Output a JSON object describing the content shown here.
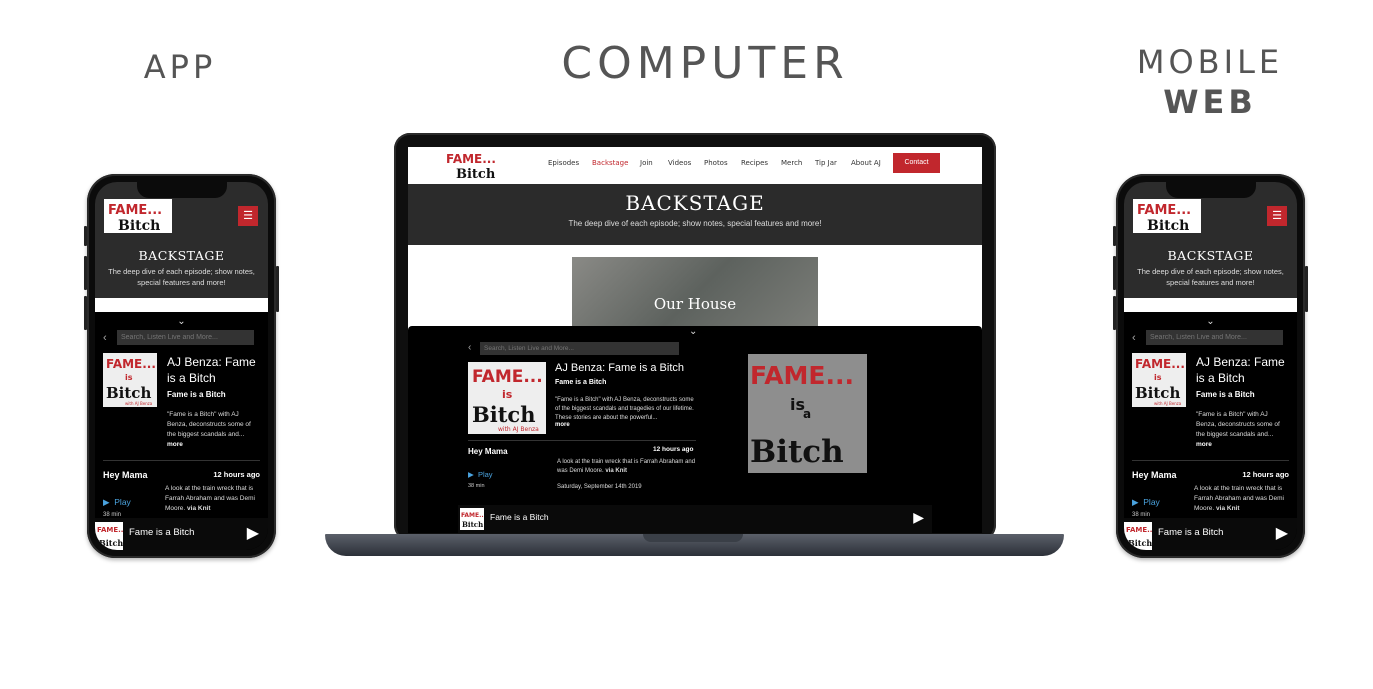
{
  "headings": {
    "app": "APP",
    "computer": "COMPUTER",
    "mobile_line1": "MOBILE",
    "mobile_line2": "WEB"
  },
  "site": {
    "nav": [
      "Episodes",
      "Backstage",
      "Join",
      "Videos",
      "Photos",
      "Recipes",
      "Merch",
      "Tip Jar",
      "About AJ"
    ],
    "active_nav": "Backstage",
    "contact_label": "Contact",
    "page_title": "BACKSTAGE",
    "page_subtitle": "The deep dive of each episode; show notes, special features and more!",
    "card_title": "Our House",
    "menu_icon": "hamburger-icon",
    "logo": {
      "line1": "FAME...",
      "line2": "Bitch"
    }
  },
  "player": {
    "search_placeholder": "Search, Listen Live and More...",
    "podcast_title": "AJ Benza: Fame is a Bitch",
    "podcast_name": "Fame is a Bitch",
    "desc_short": "\"Fame is a Bitch\" with AJ Benza, deconstructs some of the biggest scandals and...",
    "desc_long": "\"Fame is a Bitch\" with AJ Benza, deconstructs some of the biggest scandals and tragedies of our lifetime. These stories are about the powerful...",
    "more": "more",
    "episode_title": "Hey Mama",
    "episode_ago": "12 hours ago",
    "episode_desc": "A look at the train wreck that is Farrah Abraham and was Demi Moore.",
    "via": "via Knit",
    "episode_date": "Saturday, September 14th 2019",
    "play_label": "Play",
    "duration": "38 min",
    "now_playing": "Fame is a Bitch",
    "art": {
      "fame": "FAME...",
      "is": "is",
      "a": "a",
      "bitch": "Bitch",
      "with": "with AJ Benza"
    }
  },
  "colors": {
    "accent": "#c1272d",
    "dark": "#2b2b2b",
    "link": "#4aa3df"
  }
}
